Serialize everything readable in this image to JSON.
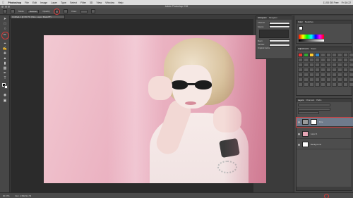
{
  "menubar": {
    "apple": "",
    "items": [
      "Photoshop",
      "File",
      "Edit",
      "Image",
      "Layer",
      "Type",
      "Select",
      "Filter",
      "3D",
      "View",
      "Window",
      "Help"
    ],
    "right_status": [
      "11.53 GB Free",
      "Fri 16:22"
    ]
  },
  "window": {
    "title": "Adobe Photoshop CS6"
  },
  "options": {
    "mode_label": "Mode:",
    "mode_value": "Normal",
    "opacity_label": "Opacity:",
    "flow_label": "Flow:"
  },
  "document": {
    "tab_title": "Untitled-1 @ 66.7% (Fine, Layer Mask/8*)"
  },
  "histogram": {
    "tabs": [
      "Histogram",
      "Navigator"
    ],
    "rows": [
      {
        "label": "Channel:",
        "value": ""
      },
      {
        "label": "Source:",
        "value": ""
      },
      {
        "label": "Mean:",
        "value": ""
      },
      {
        "label": "Std Dev:",
        "value": ""
      }
    ],
    "footer_left": "Original Cache",
    "footer_right": ""
  },
  "color_panel": {
    "tabs": [
      "Color",
      "Swatches"
    ]
  },
  "adjustments_panel": {
    "tabs": [
      "Adjustments",
      "Styles"
    ]
  },
  "layers_panel": {
    "tabs": [
      "Layers",
      "Channels",
      "Paths"
    ],
    "layers": [
      {
        "name": "Fine",
        "selected": true,
        "thumb": "#9a9a9a"
      },
      {
        "name": "Layer 1",
        "selected": false,
        "thumb": "#e7a7b6"
      },
      {
        "name": "Background",
        "selected": false,
        "thumb": "#ffffff"
      }
    ]
  },
  "statusbar": {
    "zoom": "66.67%",
    "doc_info": "Doc: 2.35M/11.7M"
  },
  "colors": {
    "accent_highlight": "#d23a3a",
    "photo_pink": "#ebb3c2"
  }
}
